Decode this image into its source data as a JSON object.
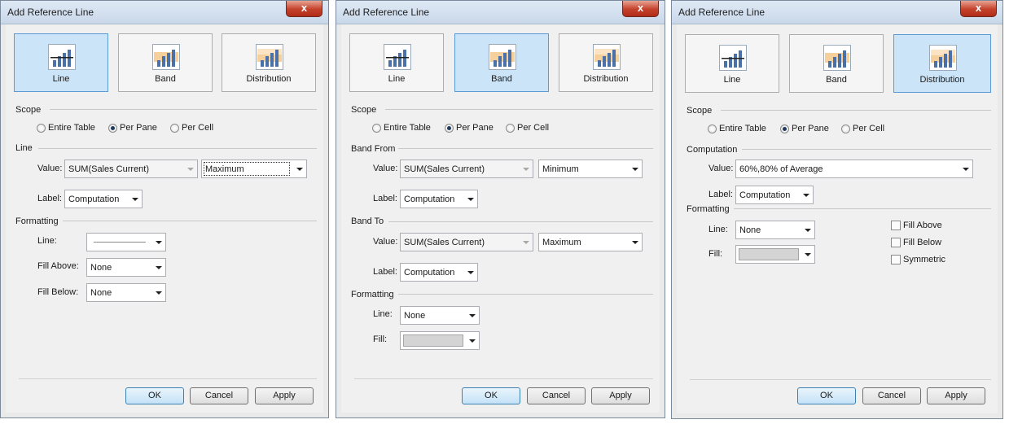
{
  "dialogs": [
    {
      "title": "Add Reference Line",
      "close_label": "x",
      "types": {
        "line": "Line",
        "band": "Band",
        "distribution": "Distribution",
        "selected": "Line"
      },
      "scope": {
        "heading": "Scope",
        "entire_table": "Entire Table",
        "per_pane": "Per Pane",
        "per_cell": "Per Cell",
        "selected": "Per Pane"
      },
      "line": {
        "heading": "Line",
        "value_label": "Value:",
        "value_field": "SUM(Sales Current)",
        "value_agg": "Maximum",
        "label_label": "Label:",
        "label_value": "Computation"
      },
      "formatting": {
        "heading": "Formatting",
        "line_label": "Line:",
        "fill_above_label": "Fill Above:",
        "fill_above_value": "None",
        "fill_below_label": "Fill Below:",
        "fill_below_value": "None"
      },
      "buttons": {
        "ok": "OK",
        "cancel": "Cancel",
        "apply": "Apply"
      }
    },
    {
      "title": "Add Reference Line",
      "close_label": "x",
      "types": {
        "line": "Line",
        "band": "Band",
        "distribution": "Distribution",
        "selected": "Band"
      },
      "scope": {
        "heading": "Scope",
        "entire_table": "Entire Table",
        "per_pane": "Per Pane",
        "per_cell": "Per Cell",
        "selected": "Per Pane"
      },
      "band_from": {
        "heading": "Band From",
        "value_label": "Value:",
        "value_field": "SUM(Sales Current)",
        "value_agg": "Minimum",
        "label_label": "Label:",
        "label_value": "Computation"
      },
      "band_to": {
        "heading": "Band To",
        "value_label": "Value:",
        "value_field": "SUM(Sales Current)",
        "value_agg": "Maximum",
        "label_label": "Label:",
        "label_value": "Computation"
      },
      "formatting": {
        "heading": "Formatting",
        "line_label": "Line:",
        "line_value": "None",
        "fill_label": "Fill:"
      },
      "buttons": {
        "ok": "OK",
        "cancel": "Cancel",
        "apply": "Apply"
      }
    },
    {
      "title": "Add Reference Line",
      "close_label": "x",
      "types": {
        "line": "Line",
        "band": "Band",
        "distribution": "Distribution",
        "selected": "Distribution"
      },
      "scope": {
        "heading": "Scope",
        "entire_table": "Entire Table",
        "per_pane": "Per Pane",
        "per_cell": "Per Cell",
        "selected": "Per Pane"
      },
      "computation": {
        "heading": "Computation",
        "value_label": "Value:",
        "value": "60%,80% of Average",
        "label_label": "Label:",
        "label_value": "Computation"
      },
      "formatting": {
        "heading": "Formatting",
        "line_label": "Line:",
        "line_value": "None",
        "fill_label": "Fill:",
        "fill_above": "Fill Above",
        "fill_below": "Fill Below",
        "symmetric": "Symmetric"
      },
      "buttons": {
        "ok": "OK",
        "cancel": "Cancel",
        "apply": "Apply"
      }
    }
  ],
  "colors": {
    "selected_type_bg": "#cce4f7",
    "selected_type_border": "#5b9bd5",
    "close_button": "#c4412a",
    "fill_swatch": "#d4d4d4"
  }
}
